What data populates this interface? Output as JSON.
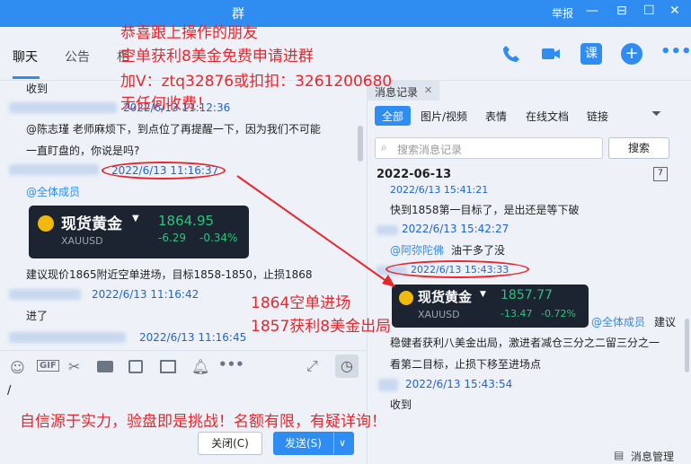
{
  "titlebar": {
    "title": "群",
    "report": "举报",
    "minimize": "—",
    "maximize": "☐",
    "close": "✕"
  },
  "tabs": {
    "chat": "聊天",
    "notice": "公告",
    "third": "相"
  },
  "left_chat": {
    "msg_shoudao": "收到",
    "ts1": "2022/6/13 11:12:36",
    "msg_long1": "@陈志瑾 老师麻烦下，到点位了再提醒一下，因为我们不可能",
    "msg_long2": "一直盯盘的，你说是吗?",
    "ts2": "2022/6/13 11:16:37",
    "mention_all": "@全体成员",
    "card": {
      "name": "现货黄金",
      "symbol": "XAUUSD",
      "price": "1864.95",
      "change": "-6.29",
      "pct": "-0.34%"
    },
    "advice": "建议现价1865附近空单进场，目标1858-1850，止损1868",
    "ts3": "2022/6/13 11:16:42",
    "msg_jinle": "进了",
    "ts4": "2022/6/13 11:16:45"
  },
  "editor": {
    "cursor": "/",
    "close_btn": "关闭(C)",
    "send_btn": "发送(S)",
    "send_caret": "∨"
  },
  "history": {
    "header": "消息记录",
    "close": "✕",
    "filters": [
      "全部",
      "图片/视频",
      "表情",
      "在线文档",
      "链接"
    ],
    "search_placeholder": "搜索消息记录",
    "search_btn": "搜索",
    "date": "2022-06-13",
    "r_ts1": "2022/6/13 15:41:21",
    "r_msg1": "快到1858第一目标了，是出还是等下破",
    "r_ts2": "2022/6/13 15:42:27",
    "r_mention": "@阿弥陀佛",
    "r_msg2": "油干多了没",
    "r_ts3": "2022/6/13 15:43:33",
    "card": {
      "name": "现货黄金",
      "symbol": "XAUUSD",
      "price": "1857.77",
      "change": "-13.47",
      "pct": "-0.72%"
    },
    "r_mention_all": "@全体成员",
    "r_msg3a": "建议",
    "r_msg3b": "稳健者获利八美金出局，激进者减仓三分之二留三分之一",
    "r_msg3c": "看第二目标，止损下移至进场点",
    "r_ts4": "2022/6/13 15:43:54",
    "r_msg4": "收到",
    "manage": "消息管理"
  },
  "overlay": {
    "line1": "恭喜跟上操作的朋友",
    "line2": "空单获利8美金免费申请进群",
    "line3": "加V：ztq32876或扣扣：3261200680",
    "line4": "无任何收费！",
    "mid1": "1864空单进场",
    "mid2": "1857获利8美金出局",
    "bottom": "自信源于实力，验盘即是挑战！名额有限，有疑详询！"
  },
  "colors": {
    "accent": "#2f8cf0",
    "overlay_red": "#e8262b",
    "timestamp": "#1f63d5",
    "gain": "#2fc27c"
  }
}
